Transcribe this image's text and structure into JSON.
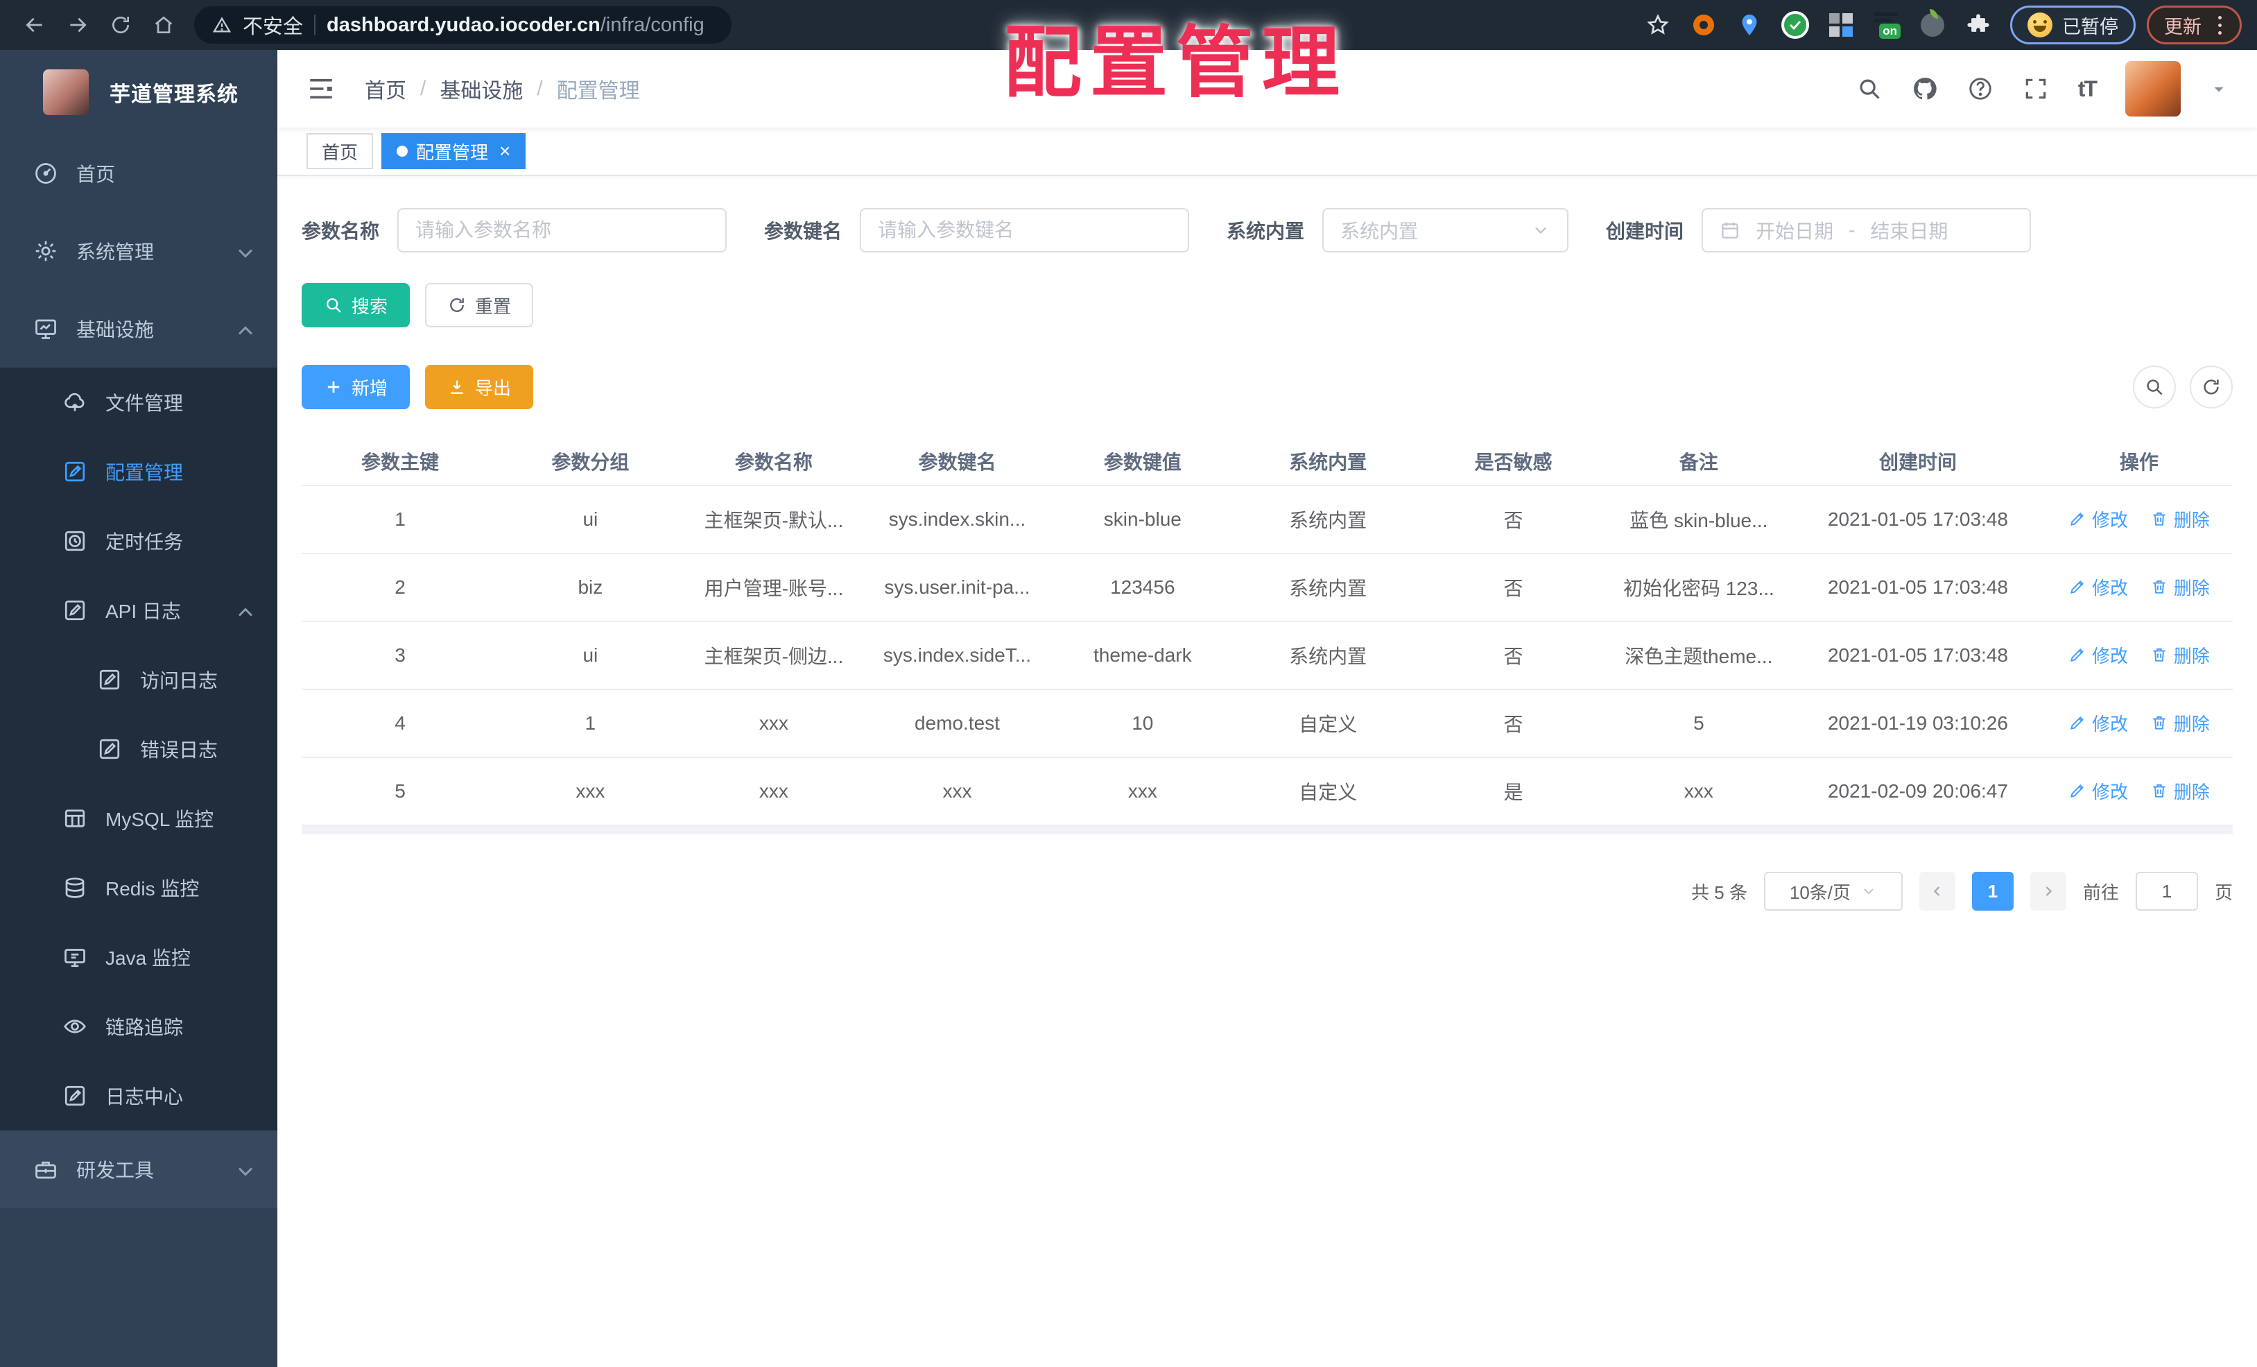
{
  "colors": {
    "primary": "#409eff",
    "tab_active": "#2d8cf0",
    "success_btn": "#1abc9c",
    "warning_btn": "#f0a020",
    "sidebar_bg": "#304156",
    "submenu_bg": "#1f2d3d",
    "browser_bg": "#1f2a35",
    "watermark": "#ee2f55"
  },
  "icons": {
    "back-icon": "←",
    "forward-icon": "→",
    "reload-icon": "⟳",
    "home-icon": "⌂",
    "warning-icon": "⚠",
    "bookmark-star-icon": "☆",
    "extensions-puzzle-icon": "puzzle",
    "menu-dots-icon": "⋮",
    "search-icon": "⌕",
    "github-icon": "octocat",
    "help-icon": "?",
    "fullscreen-icon": "⛶",
    "font-size-icon": "tT",
    "caret-down-icon": "▾",
    "chevron-down-icon": "v",
    "chevron-up-icon": "^",
    "calendar-icon": "▦",
    "plus-icon": "+",
    "download-icon": "↓",
    "refresh-icon": "⟳",
    "edit-icon": "✎",
    "trash-icon": "🗑"
  },
  "browser": {
    "security_text": "不安全",
    "url_host": "dashboard.yudao.iocoder.cn",
    "url_path": "/infra/config",
    "paused_label": "已暂停",
    "update_label": "更新"
  },
  "watermark": {
    "text": "配置管理"
  },
  "sidebar": {
    "title": "芋道管理系统",
    "items": [
      {
        "label": "首页"
      },
      {
        "label": "系统管理"
      },
      {
        "label": "基础设施"
      },
      {
        "label": "文件管理"
      },
      {
        "label": "配置管理"
      },
      {
        "label": "定时任务"
      },
      {
        "label": "API 日志"
      },
      {
        "label": "访问日志"
      },
      {
        "label": "错误日志"
      },
      {
        "label": "MySQL 监控"
      },
      {
        "label": "Redis 监控"
      },
      {
        "label": "Java 监控"
      },
      {
        "label": "链路追踪"
      },
      {
        "label": "日志中心"
      },
      {
        "label": "研发工具"
      }
    ]
  },
  "header": {
    "breadcrumb": [
      "首页",
      "基础设施",
      "配置管理"
    ],
    "separator": "/",
    "font_size_label": "tT"
  },
  "tabs": [
    {
      "label": "首页"
    },
    {
      "label": "配置管理",
      "close": "×"
    }
  ],
  "form": {
    "name_label": "参数名称",
    "name_placeholder": "请输入参数名称",
    "key_label": "参数键名",
    "key_placeholder": "请输入参数键名",
    "builtin_label": "系统内置",
    "builtin_placeholder": "系统内置",
    "created_label": "创建时间",
    "date_start_placeholder": "开始日期",
    "date_separator": "-",
    "date_end_placeholder": "结束日期"
  },
  "buttons": {
    "search_label": "搜索",
    "reset_label": "重置",
    "add_label": "新增",
    "export_label": "导出"
  },
  "table": {
    "headers": [
      "参数主键",
      "参数分组",
      "参数名称",
      "参数键名",
      "参数键值",
      "系统内置",
      "是否敏感",
      "备注",
      "创建时间",
      "操作"
    ],
    "actions": {
      "edit": "修改",
      "delete": "删除"
    },
    "rows": [
      [
        "1",
        "ui",
        "主框架页-默认...",
        "sys.index.skin...",
        "skin-blue",
        "系统内置",
        "否",
        "蓝色 skin-blue...",
        "2021-01-05 17:03:48"
      ],
      [
        "2",
        "biz",
        "用户管理-账号...",
        "sys.user.init-pa...",
        "123456",
        "系统内置",
        "否",
        "初始化密码 123...",
        "2021-01-05 17:03:48"
      ],
      [
        "3",
        "ui",
        "主框架页-侧边...",
        "sys.index.sideT...",
        "theme-dark",
        "系统内置",
        "否",
        "深色主题theme...",
        "2021-01-05 17:03:48"
      ],
      [
        "4",
        "1",
        "xxx",
        "demo.test",
        "10",
        "自定义",
        "否",
        "5",
        "2021-01-19 03:10:26"
      ],
      [
        "5",
        "xxx",
        "xxx",
        "xxx",
        "xxx",
        "自定义",
        "是",
        "xxx",
        "2021-02-09 20:06:47"
      ]
    ]
  },
  "pagination": {
    "total_label": "共 5 条",
    "page_size_label": "10条/页",
    "current_page": "1",
    "goto_label": "前往",
    "goto_value": "1",
    "goto_suffix": "页"
  }
}
